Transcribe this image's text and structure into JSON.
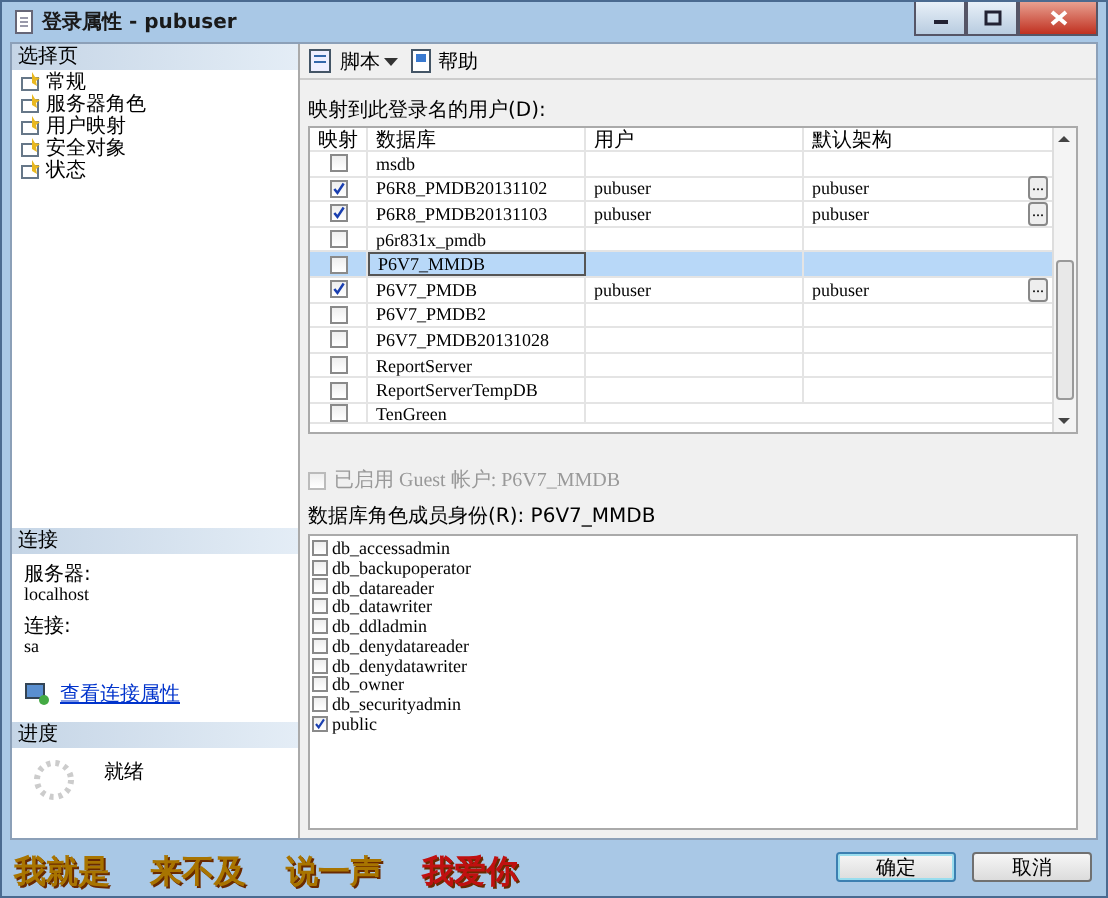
{
  "window": {
    "title": "登录属性 - pubuser"
  },
  "sidebar": {
    "title": "选择页",
    "items": [
      {
        "label": "常规",
        "selected": false
      },
      {
        "label": "服务器角色",
        "selected": false
      },
      {
        "label": "用户映射",
        "selected": false
      },
      {
        "label": "安全对象",
        "selected": false
      },
      {
        "label": "状态",
        "selected": false
      }
    ]
  },
  "connection": {
    "title": "连接",
    "server_label": "服务器:",
    "server": "localhost",
    "conn_label": "连接:",
    "conn": "sa",
    "link": "查看连接属性"
  },
  "progress": {
    "title": "进度",
    "status": "就绪"
  },
  "toolbar": {
    "script": "脚本",
    "help": "帮助"
  },
  "mapping": {
    "label": "映射到此登录名的用户(D):",
    "columns": [
      "映射",
      "数据库",
      "用户",
      "默认架构"
    ],
    "rows": [
      {
        "checked": false,
        "selected": false,
        "database": "msdb"
      },
      {
        "checked": true,
        "selected": false,
        "database": "P6R8_PMDB20131102",
        "user": "pubuser",
        "schema": "pubuser",
        "browse": "..."
      },
      {
        "checked": true,
        "selected": false,
        "database": "P6R8_PMDB20131103",
        "user": "pubuser",
        "schema": "pubuser",
        "browse": "..."
      },
      {
        "checked": false,
        "selected": false,
        "database": "p6r831x_pmdb"
      },
      {
        "checked": false,
        "selected": true,
        "database": "P6V7_MMDB"
      },
      {
        "checked": true,
        "selected": false,
        "database": "P6V7_PMDB",
        "user": "pubuser",
        "schema": "pubuser",
        "browse": "..."
      },
      {
        "checked": false,
        "selected": false,
        "database": "P6V7_PMDB2"
      },
      {
        "checked": false,
        "selected": false,
        "database": "P6V7_PMDB20131028"
      },
      {
        "checked": false,
        "selected": false,
        "database": "ReportServer"
      },
      {
        "checked": false,
        "selected": false,
        "database": "ReportServerTempDB"
      },
      {
        "checked": false,
        "selected": false,
        "database": "TenGreen"
      }
    ]
  },
  "guest": {
    "label": "已启用 Guest 帐户: P6V7_MMDB",
    "checked": false,
    "disabled": true
  },
  "roles": {
    "label": "数据库角色成员身份(R): P6V7_MMDB",
    "items": [
      {
        "name": "db_accessadmin",
        "checked": false
      },
      {
        "name": "db_backupoperator",
        "checked": false
      },
      {
        "name": "db_datareader",
        "checked": false
      },
      {
        "name": "db_datawriter",
        "checked": false
      },
      {
        "name": "db_ddladmin",
        "checked": false
      },
      {
        "name": "db_denydatareader",
        "checked": false
      },
      {
        "name": "db_denydatawriter",
        "checked": false
      },
      {
        "name": "db_owner",
        "checked": false
      },
      {
        "name": "db_securityadmin",
        "checked": false
      },
      {
        "name": "public",
        "checked": true
      }
    ]
  },
  "lyrics": [
    {
      "text": "我就是",
      "color": "#a87400"
    },
    {
      "text": "来不及",
      "color": "#a87400"
    },
    {
      "text": "说一声",
      "color": "#a87400"
    },
    {
      "text": "我爱你",
      "color": "#c01010"
    }
  ],
  "buttons": [
    {
      "label": "确定",
      "selected": true
    },
    {
      "label": "取消",
      "selected": false
    }
  ]
}
